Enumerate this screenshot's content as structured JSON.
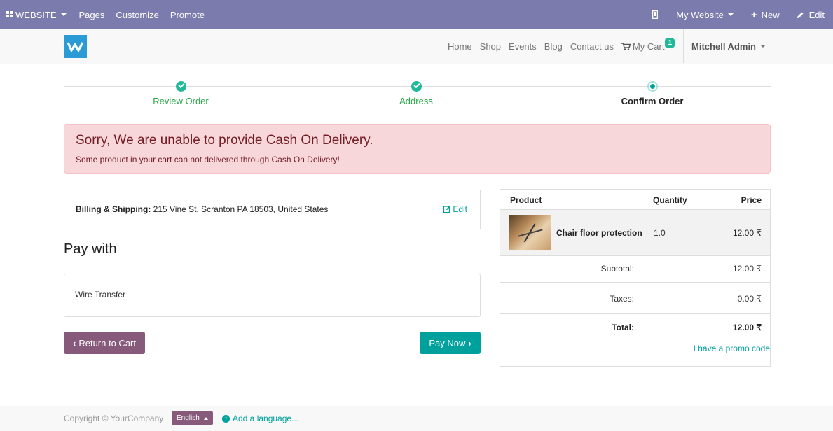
{
  "adminbar": {
    "app_label": "WEBSITE",
    "menu": [
      "Pages",
      "Customize",
      "Promote"
    ],
    "website_label": "My Website",
    "new_label": "New",
    "edit_label": "Edit"
  },
  "header": {
    "nav": [
      "Home",
      "Shop",
      "Events",
      "Blog",
      "Contact us"
    ],
    "cart_label": "My Cart",
    "cart_count": "1",
    "user_label": "Mitchell Admin"
  },
  "wizard": {
    "steps": [
      {
        "label": "Review Order",
        "state": "done"
      },
      {
        "label": "Address",
        "state": "done"
      },
      {
        "label": "Confirm Order",
        "state": "active"
      }
    ]
  },
  "alert": {
    "heading": "Sorry, We are unable to provide Cash On Delivery.",
    "message": "Some product in your cart can not delivered through Cash On Delivery!"
  },
  "billing": {
    "label": "Billing & Shipping:",
    "address": " 215 Vine St, Scranton PA 18503, United States",
    "edit_label": "Edit"
  },
  "payment": {
    "heading": "Pay with",
    "option": "Wire Transfer",
    "return_label": "Return to Cart",
    "pay_label": "Pay Now"
  },
  "summary": {
    "headers": {
      "product": "Product",
      "quantity": "Quantity",
      "price": "Price"
    },
    "line": {
      "name": "Chair floor protection",
      "quantity": "1.0",
      "price": "12.00 ₹"
    },
    "subtotal_label": "Subtotal:",
    "subtotal": "12.00 ₹",
    "taxes_label": "Taxes:",
    "taxes": "0.00 ₹",
    "total_label": "Total:",
    "total": "12.00 ₹",
    "promo_label": "I have a promo code"
  },
  "footer": {
    "copyright": "Copyright © YourCompany",
    "language": "English",
    "add_language": "Add a language..."
  },
  "colors": {
    "admin_bar": "#7c7bad",
    "primary": "#00a09d",
    "secondary": "#875a7b",
    "success": "#28a745",
    "alert_bg": "#f8d7da"
  }
}
